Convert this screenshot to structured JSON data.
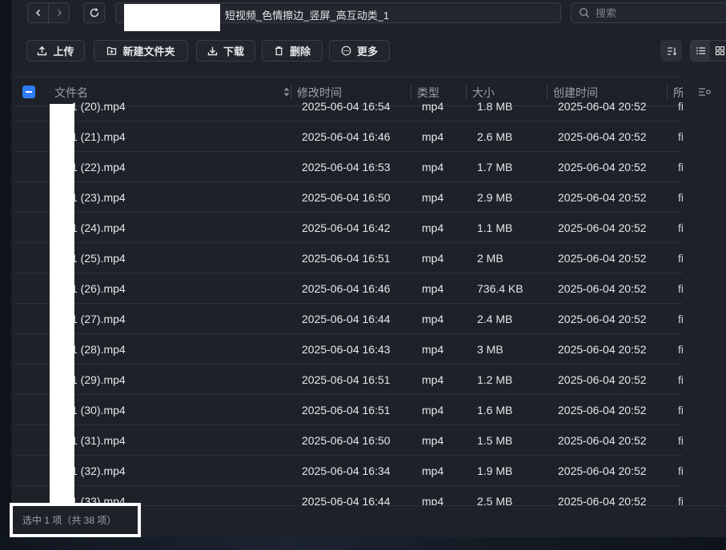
{
  "nav": {
    "path": "短视频_色情擦边_竖屏_高互动类_1",
    "search_placeholder": "搜索"
  },
  "toolbar": {
    "upload": "上传",
    "new_folder": "新建文件夹",
    "download": "下载",
    "delete": "删除",
    "more": "更多"
  },
  "columns": {
    "name": "文件名",
    "modified": "修改时间",
    "type": "类型",
    "size": "大小",
    "created": "创建时间",
    "extra": "所"
  },
  "rows": [
    {
      "name": "1 (20).mp4",
      "modified": "2025-06-04 16:54",
      "type": "mp4",
      "size": "1.8 MB",
      "created": "2025-06-04 20:52",
      "extra": "fi"
    },
    {
      "name": "1 (21).mp4",
      "modified": "2025-06-04 16:46",
      "type": "mp4",
      "size": "2.6 MB",
      "created": "2025-06-04 20:52",
      "extra": "fi"
    },
    {
      "name": "1 (22).mp4",
      "modified": "2025-06-04 16:53",
      "type": "mp4",
      "size": "1.7 MB",
      "created": "2025-06-04 20:52",
      "extra": "fi"
    },
    {
      "name": "1 (23).mp4",
      "modified": "2025-06-04 16:50",
      "type": "mp4",
      "size": "2.9 MB",
      "created": "2025-06-04 20:52",
      "extra": "fi"
    },
    {
      "name": "1 (24).mp4",
      "modified": "2025-06-04 16:42",
      "type": "mp4",
      "size": "1.1 MB",
      "created": "2025-06-04 20:52",
      "extra": "fi"
    },
    {
      "name": "1 (25).mp4",
      "modified": "2025-06-04 16:51",
      "type": "mp4",
      "size": "2 MB",
      "created": "2025-06-04 20:52",
      "extra": "fi"
    },
    {
      "name": "1 (26).mp4",
      "modified": "2025-06-04 16:46",
      "type": "mp4",
      "size": "736.4 KB",
      "created": "2025-06-04 20:52",
      "extra": "fi"
    },
    {
      "name": "1 (27).mp4",
      "modified": "2025-06-04 16:44",
      "type": "mp4",
      "size": "2.4 MB",
      "created": "2025-06-04 20:52",
      "extra": "fi"
    },
    {
      "name": "1 (28).mp4",
      "modified": "2025-06-04 16:43",
      "type": "mp4",
      "size": "3 MB",
      "created": "2025-06-04 20:52",
      "extra": "fi"
    },
    {
      "name": "1 (29).mp4",
      "modified": "2025-06-04 16:51",
      "type": "mp4",
      "size": "1.2 MB",
      "created": "2025-06-04 20:52",
      "extra": "fi"
    },
    {
      "name": "1 (30).mp4",
      "modified": "2025-06-04 16:51",
      "type": "mp4",
      "size": "1.6 MB",
      "created": "2025-06-04 20:52",
      "extra": "fi"
    },
    {
      "name": "1 (31).mp4",
      "modified": "2025-06-04 16:50",
      "type": "mp4",
      "size": "1.5 MB",
      "created": "2025-06-04 20:52",
      "extra": "fi"
    },
    {
      "name": "1 (32).mp4",
      "modified": "2025-06-04 16:34",
      "type": "mp4",
      "size": "1.9 MB",
      "created": "2025-06-04 20:52",
      "extra": "fi"
    },
    {
      "name": "1 (33).mp4",
      "modified": "2025-06-04 16:44",
      "type": "mp4",
      "size": "2.5 MB",
      "created": "2025-06-04 20:52",
      "extra": "fi"
    }
  ],
  "status": "选中 1 项（共 38 项）"
}
